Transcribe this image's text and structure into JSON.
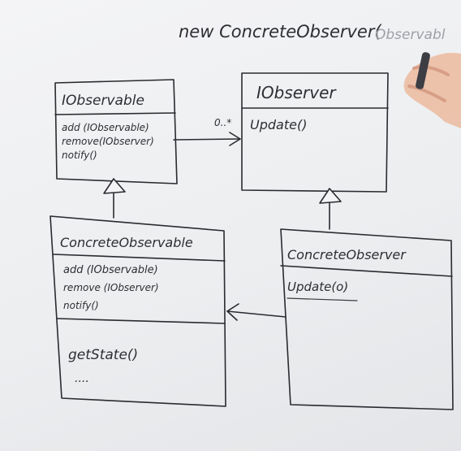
{
  "top_note": {
    "text": "new ConcreteObserver(",
    "faded_text": "Observabl"
  },
  "iobservable": {
    "name": "IObservable",
    "methods": [
      "add (IObservable)",
      "remove(IObserver)",
      "notify()"
    ]
  },
  "iobserver": {
    "name": "IObserver",
    "methods": [
      "Update()"
    ]
  },
  "concrete_observable": {
    "name": "ConcreteObservable",
    "methods": [
      "add (IObservable)",
      "remove (IObserver)",
      "notify()"
    ],
    "extra": [
      "getState()",
      "...."
    ]
  },
  "concrete_observer": {
    "name": "ConcreteObserver",
    "methods": [
      "Update(o)"
    ]
  },
  "multiplicity": "0..*",
  "colors": {
    "ink": "#2a2a30",
    "board": "#eceef0",
    "hand": "#e8b8a0"
  }
}
